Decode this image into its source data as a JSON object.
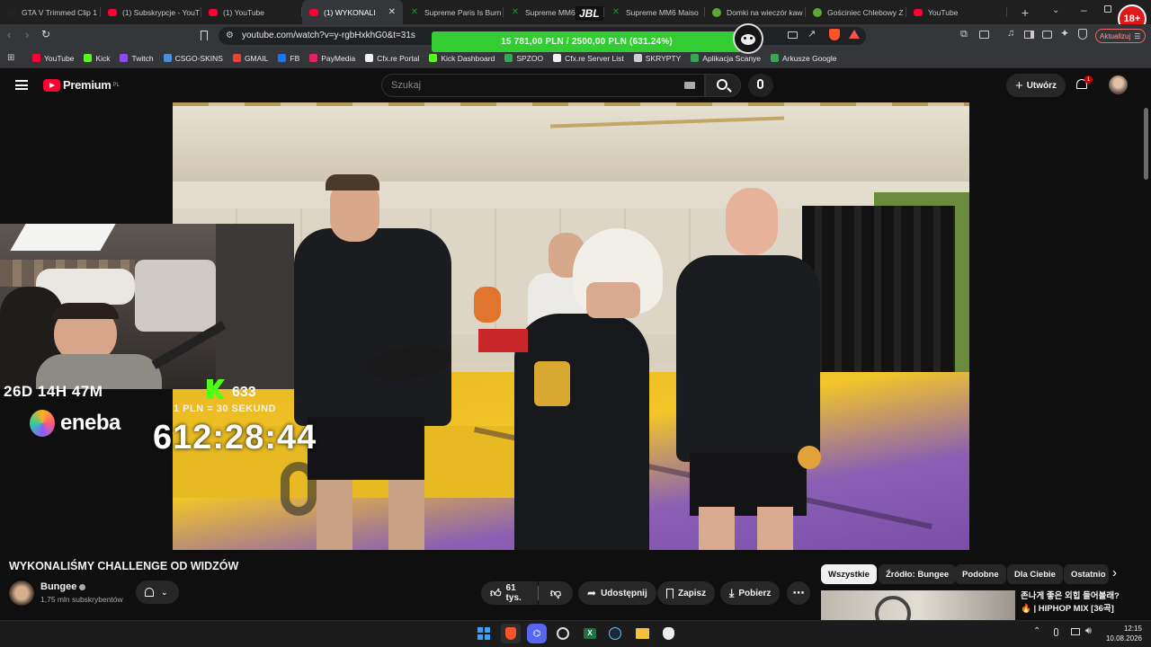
{
  "browser": {
    "tabs": [
      {
        "label": "GTA V Trimmed Clip 1",
        "icon": "m-icon",
        "color": "#222222"
      },
      {
        "label": "(1) Subskrypcje - YouT",
        "icon": "youtube-icon",
        "color": "#ff0033"
      },
      {
        "label": "(1) YouTube",
        "icon": "youtube-icon",
        "color": "#ff0033"
      },
      {
        "label": "(1) WYKONALI",
        "icon": "youtube-icon",
        "color": "#ff0033",
        "active": true
      },
      {
        "label": "Supreme Paris Is Burn",
        "icon": "x-icon",
        "color": "#1e8f4e"
      },
      {
        "label": "Supreme MM6",
        "icon": "x-icon",
        "color": "#1e8f4e"
      },
      {
        "label": "Supreme MM6 Maiso",
        "icon": "x-icon",
        "color": "#1e8f4e"
      },
      {
        "label": "Domki na wieczór kaw",
        "icon": "leaf-icon",
        "color": "#5aa832"
      },
      {
        "label": "Gościniec Chlebowy Z",
        "icon": "leaf-icon",
        "color": "#5aa832"
      },
      {
        "label": "YouTube",
        "icon": "youtube-icon",
        "color": "#ff0033"
      }
    ],
    "new_tab": "+",
    "url": "youtube.com/watch?v=y-rgbHxkhG0&t=31s",
    "update_label": "Aktualizuj",
    "bookmarks": [
      {
        "label": "YouTube",
        "color": "#ff0033"
      },
      {
        "label": "Kick",
        "color": "#53fc18"
      },
      {
        "label": "Twitch",
        "color": "#9146ff"
      },
      {
        "label": "CSGO-SKINS",
        "color": "#4a90d9"
      },
      {
        "label": "GMAIL",
        "color": "#ea4335"
      },
      {
        "label": "FB",
        "color": "#1877f2"
      },
      {
        "label": "PayMedia",
        "color": "#e0245e"
      },
      {
        "label": "Cfx.re Portal",
        "color": "#f0f0f0"
      },
      {
        "label": "Kick Dashboard",
        "color": "#53fc18"
      },
      {
        "label": "SPZOO",
        "color": "#34a853"
      },
      {
        "label": "Cfx.re Server List",
        "color": "#f0f0f0"
      },
      {
        "label": "SKRYPTY",
        "color": "#cfcfcf"
      },
      {
        "label": "Aplikacja Scanye",
        "color": "#34a853"
      },
      {
        "label": "Arkusze Google",
        "color": "#34a853"
      }
    ]
  },
  "overlay": {
    "donation_goal": "15 781,00 PLN / 2500,00 PLN (631.24%)",
    "jbl_text": "JBL",
    "age_badge": "18+",
    "countdown_days": "26D 14H 47M",
    "kick_followers": "633",
    "rate_text": "1 PLN = 30 SEKUND",
    "timer": "612:28:44",
    "sponsor": "eneba"
  },
  "youtube": {
    "logo_text": "Premium",
    "logo_region": "PL",
    "search_placeholder": "Szukaj",
    "create_label": "Utwórz",
    "notification_count": "1",
    "video_title": "WYKONALIŚMY CHALLENGE OD WIDZÓW",
    "channel_name": "Bungee",
    "subscribers": "1,75 mln subskrybentów",
    "likes": "61 tys.",
    "share_label": "Udostępnij",
    "save_label": "Zapisz",
    "download_label": "Pobierz",
    "chips": [
      "Wszystkie",
      "Źródło: Bungee",
      "Podobne",
      "Dla Ciebie",
      "Ostatnio"
    ],
    "sidebar_video": {
      "title_line1": "존나게 좋은 외힙 들어볼래?",
      "title_line2": "🔥 | HIPHOP MIX [36곡]"
    }
  },
  "taskbar": {
    "time": "12:15",
    "date": "10.08.2026"
  }
}
